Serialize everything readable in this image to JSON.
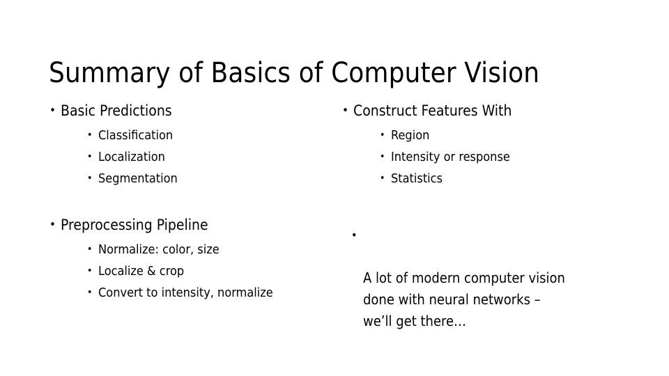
{
  "slide": {
    "title": "Summary of Basics of Computer Vision",
    "background_color": "#ffffff",
    "text_color": "#000000",
    "bullet_glyph": "•",
    "columns": {
      "left": {
        "blocks": [
          {
            "heading": "Basic Predictions",
            "items": [
              "Classification",
              "Localization",
              "Segmentation"
            ]
          },
          {
            "heading": "Preprocessing Pipeline",
            "items": [
              "Normalize: color, size",
              "Localize & crop",
              "Convert to intensity, normalize"
            ]
          }
        ]
      },
      "right": {
        "blocks": [
          {
            "heading": "Construct Features With",
            "items": [
              "Region",
              "Intensity or response",
              "Statistics"
            ]
          }
        ],
        "closing_paragraph": "A lot of modern computer vision\ndone with neural networks –\nwe’ll get there…"
      }
    }
  }
}
